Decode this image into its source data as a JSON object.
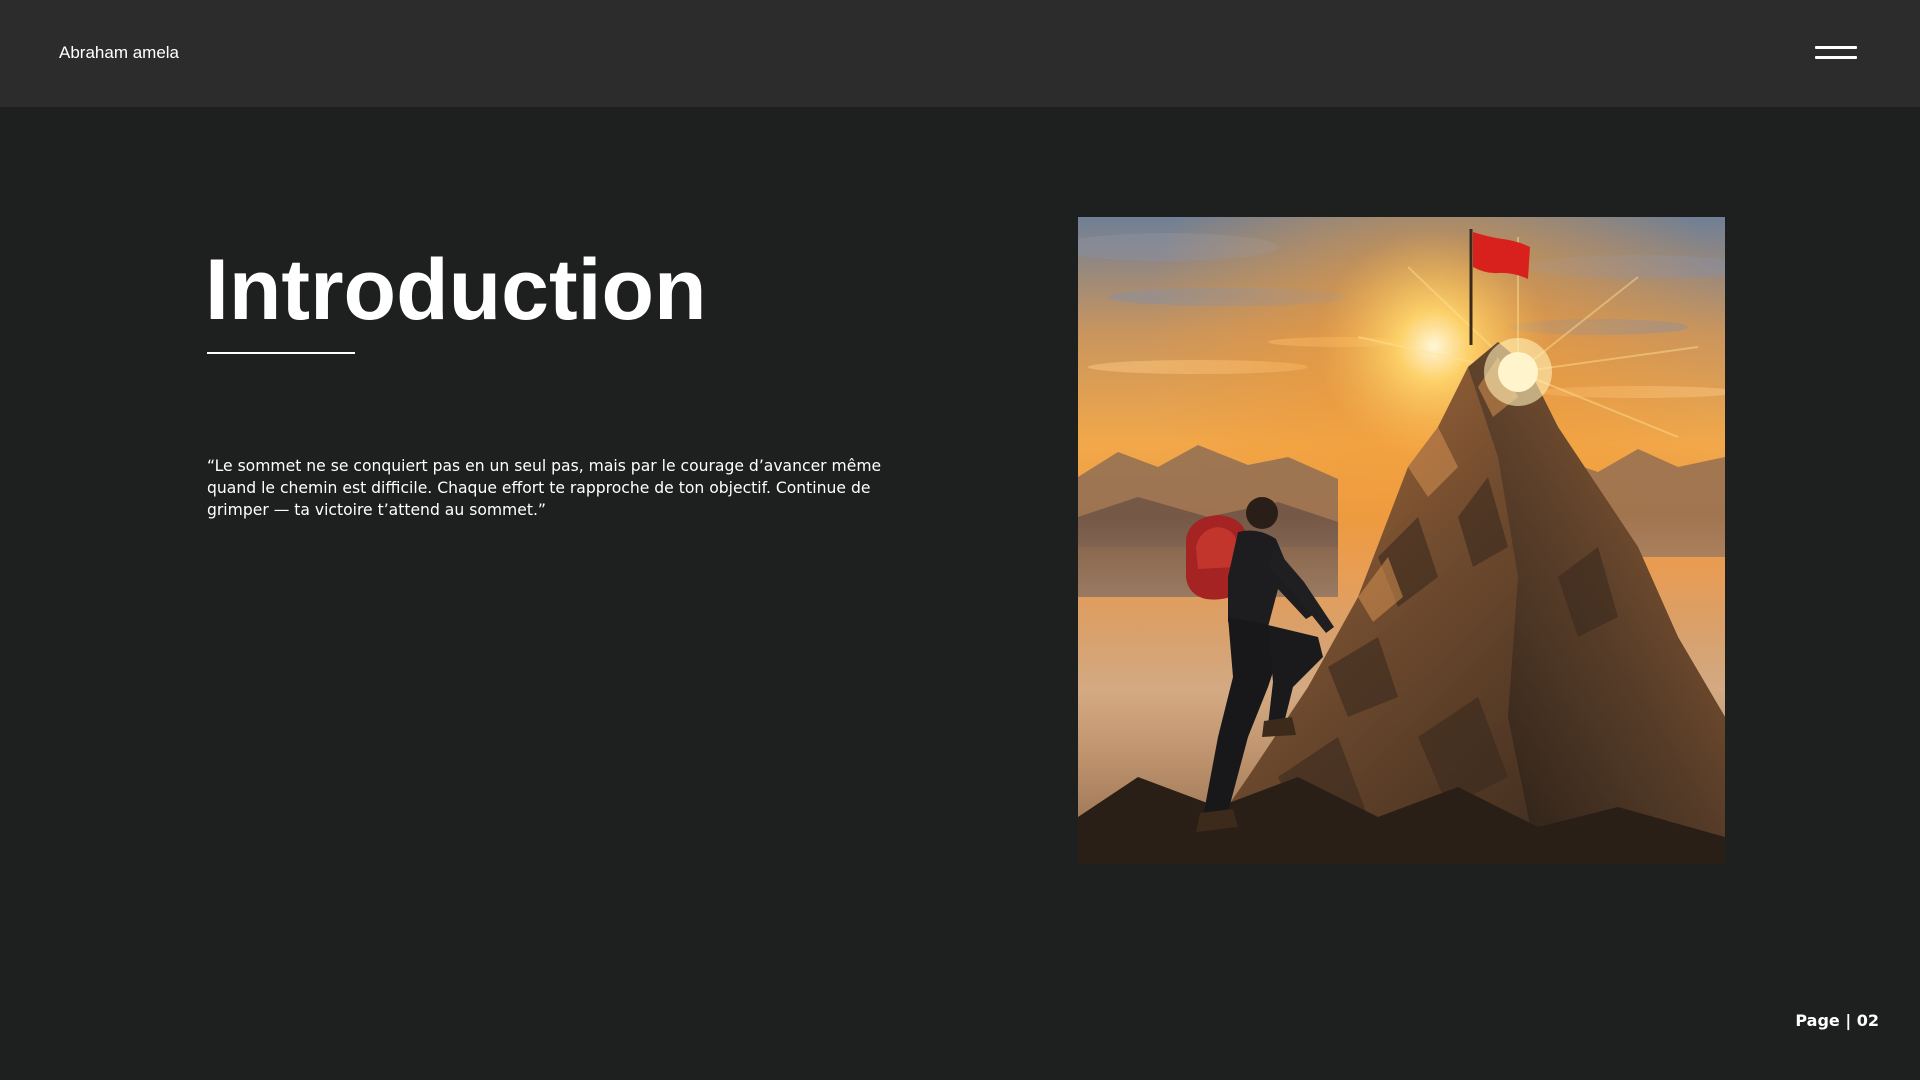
{
  "header": {
    "author": "Abraham amela",
    "menu_icon": "hamburger-menu-icon"
  },
  "slide": {
    "title": "Introduction",
    "quote": "“Le sommet ne se conquiert pas en un seul pas, mais par le courage d’avancer même quand le chemin est difficile. Chaque effort te rapproche de ton objectif. Continue de grimper — ta victoire t’attend au sommet.”",
    "image_icon": "mountain-climber-image"
  },
  "footer": {
    "page_label": "Page | 02"
  },
  "colors": {
    "background": "#1e1f1f",
    "topbar": "#2c2c2c",
    "text": "#ffffff",
    "flag": "#d8201c",
    "sun": "#ffd46a"
  }
}
